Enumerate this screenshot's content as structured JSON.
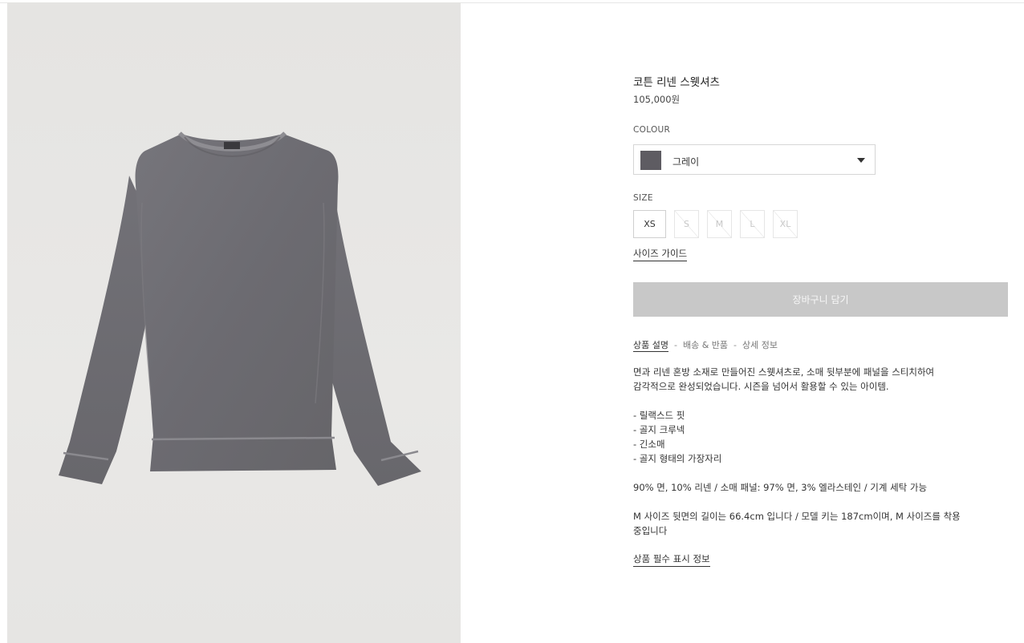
{
  "product": {
    "title": "코튼 리넨 스웻셔츠",
    "price": "105,000원",
    "image_alt": "sweater-image"
  },
  "colour": {
    "label": "COLOUR",
    "selected": "그레이",
    "swatch_color": "#5e5c62"
  },
  "size": {
    "label": "SIZE",
    "options": [
      {
        "label": "XS",
        "available": true
      },
      {
        "label": "S",
        "available": false
      },
      {
        "label": "M",
        "available": false
      },
      {
        "label": "L",
        "available": false
      },
      {
        "label": "XL",
        "available": false
      }
    ],
    "guide_label": "사이즈 가이드"
  },
  "cart": {
    "button_label": "장바구니 담기",
    "button_color": "#c8c8c8"
  },
  "tabs": [
    {
      "label": "상품 설명",
      "active": true
    },
    {
      "label": "배송 & 반품",
      "active": false
    },
    {
      "label": "상세 정보",
      "active": false
    }
  ],
  "tab_separator": "-",
  "description": {
    "intro_line1": "면과 리넨 혼방 소재로 만들어진 스웻셔츠로, 소매 뒷부분에 패널을 스티치하여",
    "intro_line2": "감각적으로 완성되었습니다. 시즌을 넘어서 활용할 수 있는 아이템.",
    "features": [
      "- 릴랙스드 핏",
      "- 골지 크루넥",
      "- 긴소매",
      "- 골지 형태의 가장자리"
    ],
    "composition": "90% 면, 10% 리넨 / 소매 패널: 97% 면, 3% 엘라스테인 / 기계 세탁 가능",
    "model_line1": "M 사이즈 뒷면의 길이는 66.4cm 입니다 / 모델 키는 187cm이며, M 사이즈를 착용",
    "model_line2": "중입니다"
  },
  "notice_link": "상품 필수 표시 정보"
}
